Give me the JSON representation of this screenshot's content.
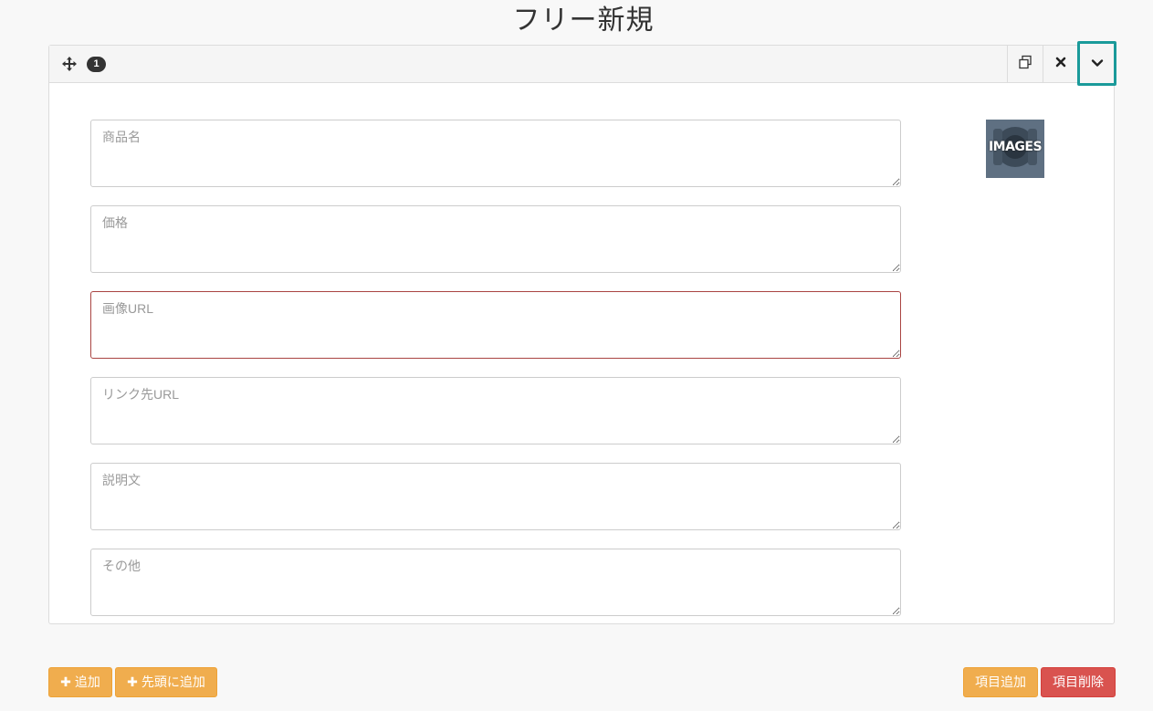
{
  "page": {
    "title": "フリー新規"
  },
  "item": {
    "number": "1",
    "icons": {
      "move": "move-arrows-icon",
      "copy": "copy-icon",
      "close": "close-icon",
      "collapse": "chevron-down-icon"
    },
    "fields": {
      "product_name": {
        "placeholder": "商品名",
        "value": ""
      },
      "price": {
        "placeholder": "価格",
        "value": ""
      },
      "image_url": {
        "placeholder": "画像URL",
        "value": ""
      },
      "link_url": {
        "placeholder": "リンク先URL",
        "value": ""
      },
      "description": {
        "placeholder": "説明文",
        "value": ""
      },
      "other": {
        "placeholder": "その他",
        "value": ""
      }
    },
    "preview": {
      "label": "IMAGES"
    }
  },
  "footer": {
    "add_label": "追加",
    "add_first_label": "先頭に追加",
    "add_field_label": "項目追加",
    "delete_field_label": "項目削除"
  },
  "colors": {
    "accent": "#1a9a9a",
    "warning": "#f0ad4e",
    "danger": "#d9534f",
    "invalid_border": "#a94442"
  }
}
